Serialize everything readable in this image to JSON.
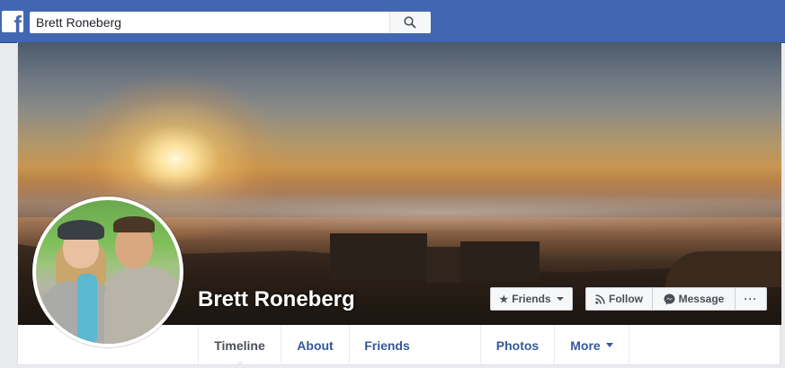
{
  "search": {
    "value": "Brett Roneberg",
    "placeholder": "Search"
  },
  "logo": {
    "glyph": "f"
  },
  "profile": {
    "name": "Brett Roneberg"
  },
  "actions": {
    "friends_label": "Friends",
    "follow_label": "Follow",
    "message_label": "Message",
    "more_glyph": "···"
  },
  "nav": {
    "tabs": [
      {
        "label": "Timeline"
      },
      {
        "label": "About"
      },
      {
        "label": "Friends"
      },
      {
        "label": "Photos"
      },
      {
        "label": "More"
      }
    ]
  },
  "colors": {
    "brand": "#4267b2",
    "link": "#365899",
    "text": "#4b4f56"
  }
}
